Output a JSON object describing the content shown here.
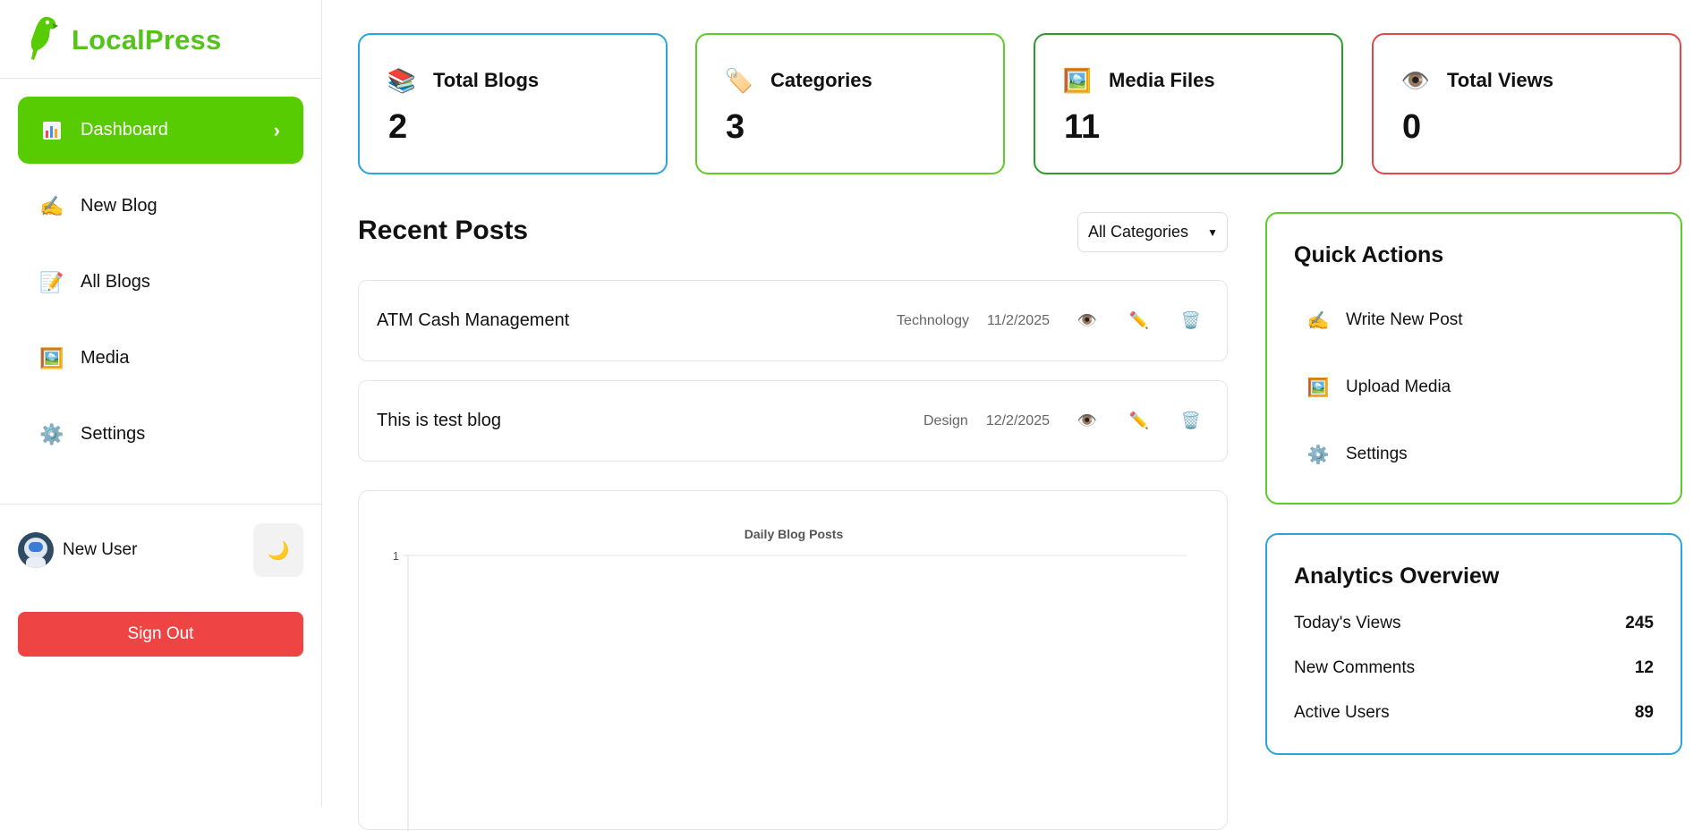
{
  "brand": {
    "name": "LocalPress",
    "accent": "#58cc02"
  },
  "sidebar": {
    "items": [
      {
        "label": "Dashboard",
        "icon": "bar-chart-icon",
        "active": true
      },
      {
        "label": "New Blog",
        "icon": "writing-hand-icon"
      },
      {
        "label": "All Blogs",
        "icon": "document-icon"
      },
      {
        "label": "Media",
        "icon": "picture-icon"
      },
      {
        "label": "Settings",
        "icon": "gear-icon"
      }
    ],
    "user": {
      "name": "New User"
    },
    "theme_toggle_icon": "moon-icon",
    "sign_out": "Sign Out"
  },
  "stats": [
    {
      "label": "Total Blogs",
      "value": "2",
      "icon": "books-icon",
      "color": "#2aa5dc"
    },
    {
      "label": "Categories",
      "value": "3",
      "icon": "tag-icon",
      "color": "#5fcb2a"
    },
    {
      "label": "Media Files",
      "value": "11",
      "icon": "picture-icon",
      "color": "#2b9c2b"
    },
    {
      "label": "Total Views",
      "value": "0",
      "icon": "eye-icon",
      "color": "#e14848"
    }
  ],
  "recent_posts": {
    "title": "Recent Posts",
    "filter": {
      "selected": "All Categories"
    },
    "posts": [
      {
        "title": "ATM Cash Management",
        "category": "Technology",
        "date": "11/2/2025"
      },
      {
        "title": "This is test blog",
        "category": "Design",
        "date": "12/2/2025"
      }
    ]
  },
  "chart_data": {
    "type": "line",
    "title": "Daily Blog Posts",
    "xlabel": "",
    "ylabel": "",
    "y_ticks": [
      "1"
    ],
    "ylim": [
      0,
      1
    ],
    "x": [],
    "series": [],
    "grid": true
  },
  "quick_actions": {
    "title": "Quick Actions",
    "items": [
      {
        "label": "Write New Post",
        "icon": "writing-hand-icon"
      },
      {
        "label": "Upload Media",
        "icon": "picture-icon"
      },
      {
        "label": "Settings",
        "icon": "gear-icon"
      }
    ]
  },
  "analytics": {
    "title": "Analytics Overview",
    "rows": [
      {
        "label": "Today's Views",
        "value": "245"
      },
      {
        "label": "New Comments",
        "value": "12"
      },
      {
        "label": "Active Users",
        "value": "89"
      }
    ]
  }
}
